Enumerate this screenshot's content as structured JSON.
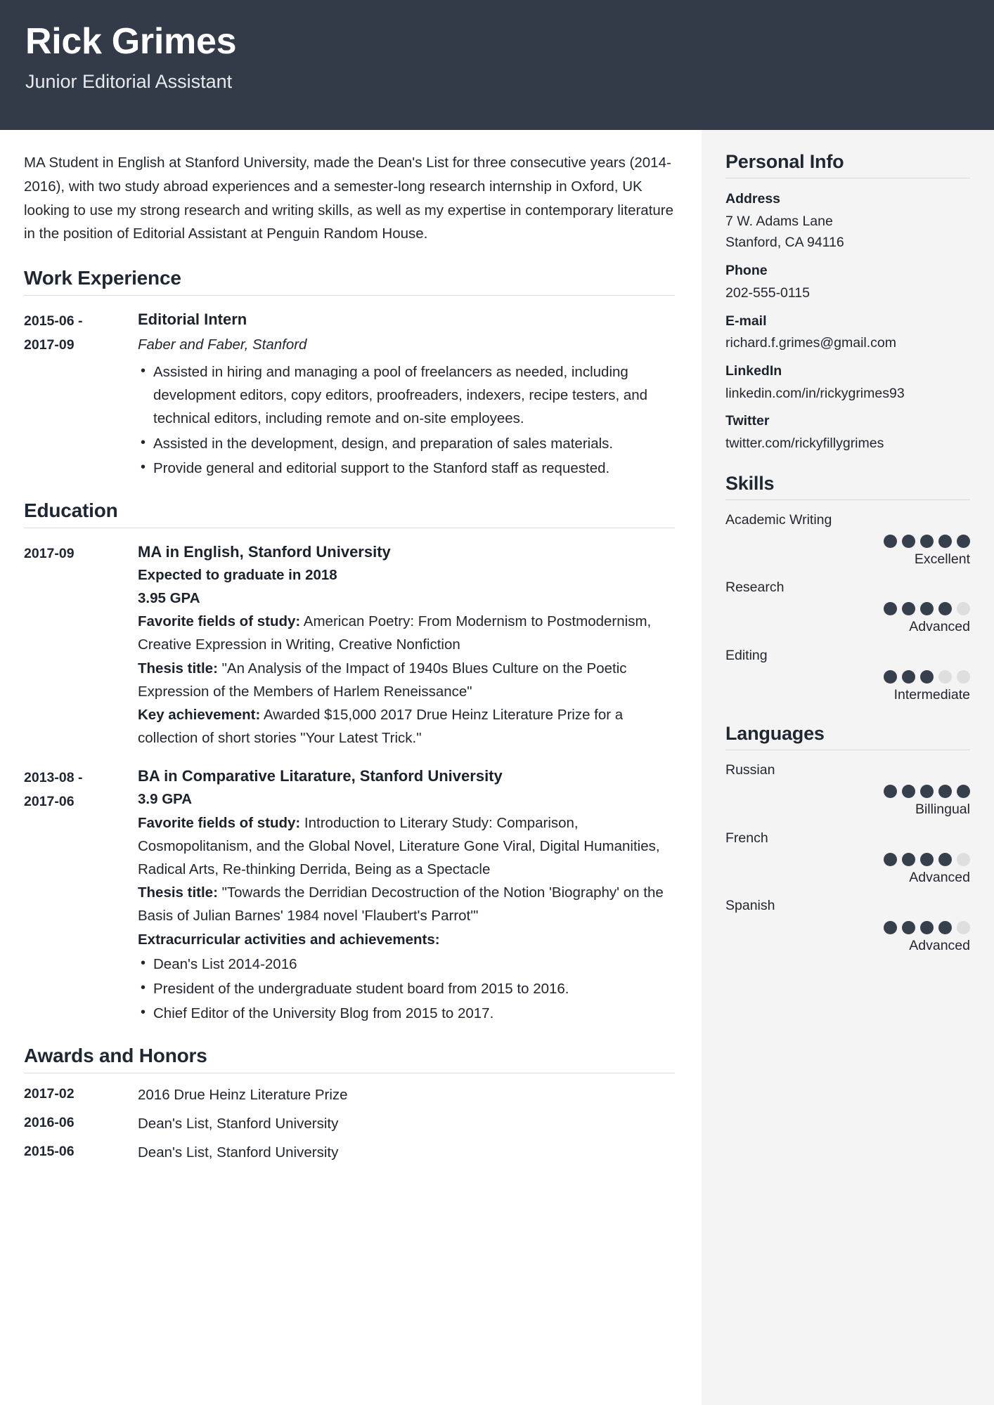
{
  "header": {
    "name": "Rick Grimes",
    "job_title": "Junior Editorial Assistant"
  },
  "main": {
    "summary": "MA Student in English at Stanford University, made the Dean's List for three consecutive years (2014-2016), with two study abroad experiences and a semester-long research internship in Oxford, UK looking to use my strong research and writing skills, as well as my expertise in contemporary literature in the position of Editorial Assistant at Penguin Random House.",
    "work_experience": {
      "heading": "Work Experience",
      "entries": [
        {
          "date_from": "2015-06 -",
          "date_to": "2017-09",
          "role": "Editorial Intern",
          "company": "Faber and Faber, Stanford",
          "bullets": [
            "Assisted in hiring and managing a pool of freelancers as needed, including development editors, copy editors, proofreaders, indexers, recipe testers, and technical editors, including remote and on-site employees.",
            "Assisted in the development, design, and preparation of sales materials.",
            "Provide general and editorial support to the Stanford staff as requested."
          ]
        }
      ]
    },
    "education": {
      "heading": "Education",
      "entries": [
        {
          "date_from": "2017-09",
          "date_to": "",
          "degree": "MA in English, Stanford University",
          "sub_lines": [
            "Expected to graduate in 2018",
            "3.95 GPA"
          ],
          "detail_lines": [
            {
              "label": "Favorite fields of study:",
              "text": " American Poetry: From Modernism to Postmodernism, Creative Expression in Writing, Creative Nonfiction"
            },
            {
              "label": "Thesis title:",
              "text": " \"An Analysis of the Impact of 1940s Blues Culture on the Poetic Expression of the Members of Harlem Reneissance\""
            },
            {
              "label": "Key achievement:",
              "text": " Awarded $15,000 2017 Drue Heinz Literature Prize for a collection of short stories \"Your Latest Trick.\""
            }
          ],
          "bullets_heading": "",
          "bullets": []
        },
        {
          "date_from": "2013-08 -",
          "date_to": "2017-06",
          "degree": "BA in Comparative Litarature, Stanford University",
          "sub_lines": [
            "3.9 GPA"
          ],
          "detail_lines": [
            {
              "label": "Favorite fields of study:",
              "text": " Introduction to Literary Study: Comparison, Cosmopolitanism, and the Global Novel, Literature Gone Viral, Digital Humanities, Radical Arts, Re-thinking Derrida, Being as a Spectacle"
            },
            {
              "label": "Thesis title:",
              "text": " \"Towards the Derridian Decostruction of the Notion 'Biography' on the Basis of Julian Barnes' 1984 novel 'Flaubert's Parrot'\""
            }
          ],
          "bullets_heading": "Extracurricular activities and achievements:",
          "bullets": [
            "Dean's List 2014-2016",
            "President of the undergraduate student board from 2015 to 2016.",
            "Chief Editor of the University Blog from 2015 to 2017."
          ]
        }
      ]
    },
    "awards": {
      "heading": "Awards and Honors",
      "rows": [
        {
          "date": "2017-02",
          "text": "2016 Drue Heinz Literature Prize"
        },
        {
          "date": "2016-06",
          "text": "Dean's List, Stanford University"
        },
        {
          "date": "2015-06",
          "text": "Dean's List, Stanford University"
        }
      ]
    }
  },
  "sidebar": {
    "personal_info": {
      "heading": "Personal Info",
      "fields": [
        {
          "label": "Address",
          "values": [
            "7 W. Adams Lane",
            "Stanford, CA 94116"
          ]
        },
        {
          "label": "Phone",
          "values": [
            "202-555-0115"
          ]
        },
        {
          "label": "E-mail",
          "values": [
            "richard.f.grimes@gmail.com"
          ]
        },
        {
          "label": "LinkedIn",
          "values": [
            "linkedin.com/in/rickygrimes93"
          ]
        },
        {
          "label": "Twitter",
          "values": [
            "twitter.com/rickyfillygrimes"
          ]
        }
      ]
    },
    "skills": {
      "heading": "Skills",
      "items": [
        {
          "name": "Academic Writing",
          "filled": 5,
          "total": 5,
          "level": "Excellent"
        },
        {
          "name": "Research",
          "filled": 4,
          "total": 5,
          "level": "Advanced"
        },
        {
          "name": "Editing",
          "filled": 3,
          "total": 5,
          "level": "Intermediate"
        }
      ]
    },
    "languages": {
      "heading": "Languages",
      "items": [
        {
          "name": "Russian",
          "filled": 5,
          "total": 5,
          "level": "Billingual"
        },
        {
          "name": "French",
          "filled": 4,
          "total": 5,
          "level": "Advanced"
        },
        {
          "name": "Spanish",
          "filled": 4,
          "total": 5,
          "level": "Advanced"
        }
      ]
    }
  },
  "colors": {
    "header_bg": "#333b48",
    "sidebar_bg": "#f4f4f4",
    "dot_filled": "#363f4c",
    "dot_empty": "#dedede",
    "text": "#22262e"
  }
}
